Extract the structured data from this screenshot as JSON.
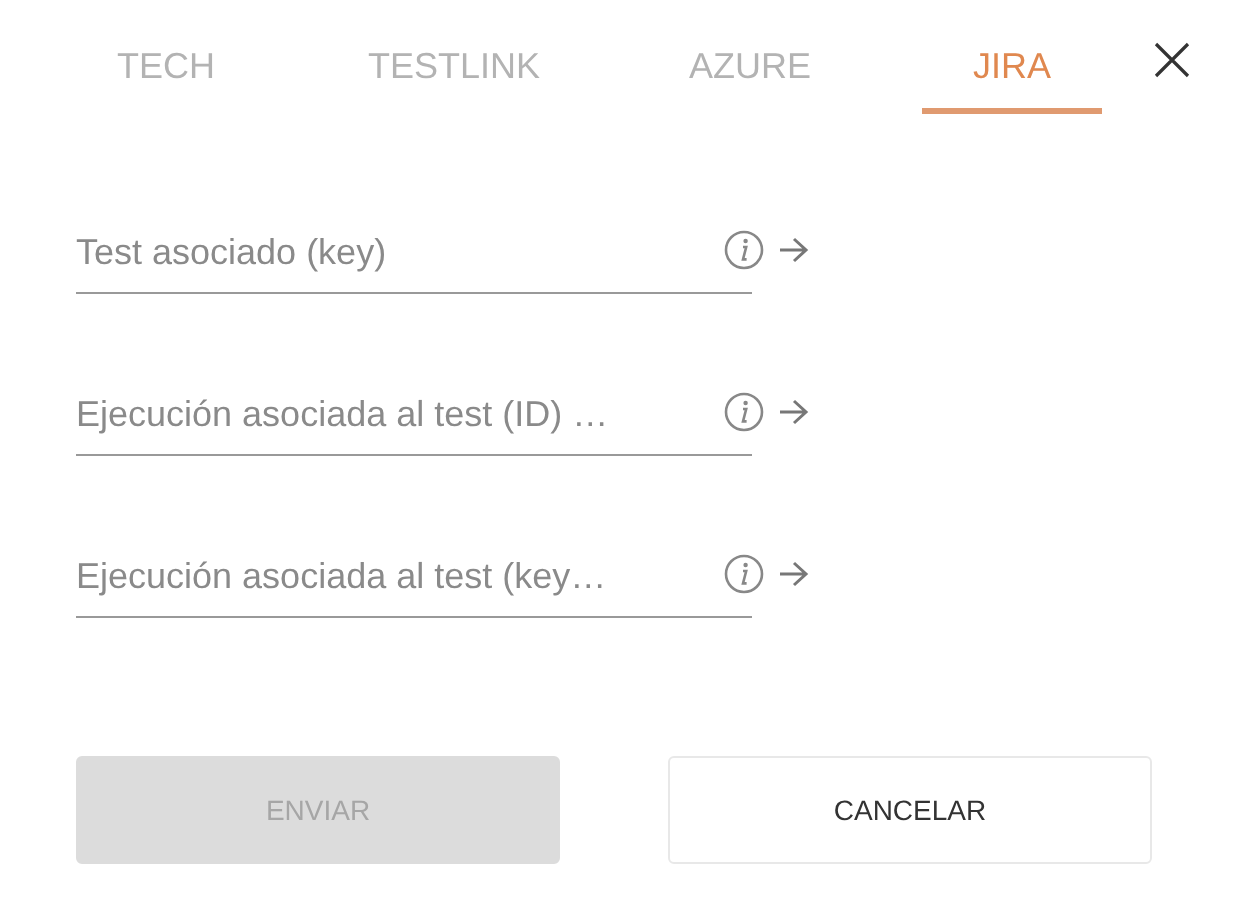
{
  "tabs": [
    {
      "label": "TECH",
      "selected": false
    },
    {
      "label": "TESTLINK",
      "selected": false
    },
    {
      "label": "AZURE",
      "selected": false
    },
    {
      "label": "JIRA",
      "selected": true
    }
  ],
  "fields": [
    {
      "placeholder": "Test asociado (key)"
    },
    {
      "placeholder": "Ejecución asociada al test (ID) …"
    },
    {
      "placeholder": "Ejecución asociada al test (key…"
    }
  ],
  "buttons": [
    {
      "label": "ENVIAR",
      "disabled": true
    },
    {
      "label": "CANCELAR",
      "disabled": false
    }
  ]
}
